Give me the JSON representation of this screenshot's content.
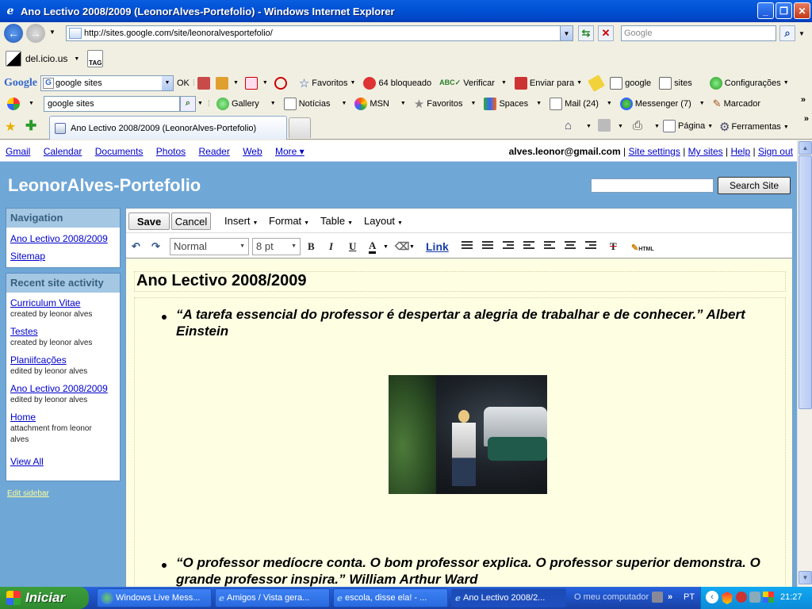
{
  "window": {
    "title": "Ano Lectivo 2008/2009 (LeonorAlves-Portefolio) - Windows Internet Explorer"
  },
  "address": {
    "url": "http://sites.google.com/site/leonoralvesportefolio/",
    "search_placeholder": "Google"
  },
  "toolbar_delicious": {
    "label": "del.icio.us",
    "tag": "TAG"
  },
  "toolbar_google": {
    "logo": "Google",
    "search_value": "google sites",
    "ok": "OK",
    "favoritos": "Favoritos",
    "blocked": "64 bloqueado",
    "verificar": "Verificar",
    "enviar": "Enviar para",
    "google": "google",
    "sites": "sites",
    "config": "Configurações"
  },
  "toolbar_msn": {
    "search_value": "google sites",
    "gallery": "Gallery",
    "noticias": "Notícias",
    "msn": "MSN",
    "favoritos": "Favoritos",
    "spaces": "Spaces",
    "mail": "Mail (24)",
    "messenger": "Messenger (7)",
    "marcador": "Marcador"
  },
  "tabs": {
    "active_title": "Ano Lectivo 2008/2009 (LeonorAlves-Portefolio)",
    "pagina": "Página",
    "ferramentas": "Ferramentas"
  },
  "gbar": {
    "links": [
      "Gmail",
      "Calendar",
      "Documents",
      "Photos",
      "Reader",
      "Web",
      "More ▾"
    ],
    "email": "alves.leonor@gmail.com",
    "right_links": [
      "Site settings",
      "My sites",
      "Help",
      "Sign out"
    ]
  },
  "site": {
    "title": "LeonorAlves-Portefolio",
    "search_button": "Search Site"
  },
  "navigation": {
    "heading": "Navigation",
    "items": [
      "Ano Lectivo 2008/2009",
      "Sitemap"
    ]
  },
  "recent": {
    "heading": "Recent site activity",
    "items": [
      {
        "title": "Curriculum Vitae",
        "meta": "created by leonor alves"
      },
      {
        "title": "Testes",
        "meta": "created by leonor alves"
      },
      {
        "title": "Planiifcações",
        "meta": "edited by leonor alves"
      },
      {
        "title": "Ano Lectivo 2008/2009",
        "meta": "edited by leonor alves"
      },
      {
        "title": "Home",
        "meta": "attachment from leonor alves"
      }
    ],
    "view_all": "View All"
  },
  "edit_sidebar": "Edit sidebar",
  "editor": {
    "save": "Save",
    "cancel": "Cancel",
    "menus": [
      "Insert",
      "Format",
      "Table",
      "Layout"
    ],
    "style_select": "Normal",
    "size_select": "8 pt",
    "bold": "B",
    "italic": "I",
    "underline": "U",
    "text_color": "A",
    "link": "Link",
    "html": "HTML",
    "page_title": "Ano Lectivo 2008/2009",
    "quote1": "“A tarefa essencial do professor é despertar a alegria de trabalhar e de conhecer.” Albert Einstein",
    "quote2": "“O professor medíocre conta. O bom professor explica. O professor superior demonstra. O grande professor inspira.” William Arthur Ward"
  },
  "taskbar": {
    "start": "Iniciar",
    "tasks": [
      "Windows Live Mess...",
      "Amigos / Vista gera...",
      "escola, disse ela! - ...",
      "Ano Lectivo 2008/2..."
    ],
    "computer": "O meu computador",
    "lang": "PT",
    "time": "21:27"
  },
  "colors": {
    "xp_blue": "#0252d6",
    "page_bg": "#6fa7d7",
    "editor_bg": "#fefee3",
    "link": "#0000cc"
  }
}
